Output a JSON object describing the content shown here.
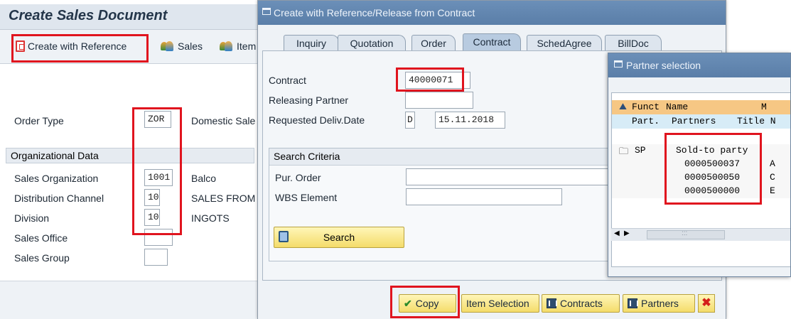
{
  "main": {
    "title": "Create Sales Document",
    "toolbar": {
      "create_with_reference": "Create with Reference",
      "sales": "Sales",
      "item": "Item"
    },
    "order_type": {
      "label": "Order Type",
      "value": "ZOR",
      "description": "Domestic Sale"
    },
    "org_section": "Organizational Data",
    "sales_org": {
      "label": "Sales Organization",
      "value": "1001",
      "description": "Balco"
    },
    "dist_channel": {
      "label": "Distribution Channel",
      "value": "10",
      "description": "SALES FROM"
    },
    "division": {
      "label": "Division",
      "value": "10",
      "description": "INGOTS"
    },
    "sales_office": {
      "label": "Sales Office",
      "value": ""
    },
    "sales_group": {
      "label": "Sales Group",
      "value": ""
    }
  },
  "ref_dialog": {
    "title": "Create with Reference/Release from Contract",
    "tabs": [
      "Inquiry",
      "Quotation",
      "Order",
      "Contract",
      "SchedAgree",
      "BillDoc"
    ],
    "active_tab": "Contract",
    "contract": {
      "label": "Contract",
      "value": "40000071"
    },
    "releasing_partner": {
      "label": "Releasing Partner",
      "value": ""
    },
    "req_deliv_date": {
      "label": "Requested Deliv.Date",
      "format": "D",
      "value": "15.11.2018"
    },
    "search_criteria": {
      "header": "Search Criteria",
      "pur_order": {
        "label": "Pur. Order",
        "value": ""
      },
      "wbs_element": {
        "label": "WBS Element",
        "value": ""
      },
      "search_button": "Search"
    },
    "footer": {
      "copy": "Copy",
      "item_selection": "Item Selection",
      "contracts": "Contracts",
      "partners": "Partners"
    }
  },
  "partner_dialog": {
    "title": "Partner selection",
    "header1": {
      "funct": "Funct",
      "name": "Name",
      "m": "M"
    },
    "header2": {
      "part": "Part.",
      "partners": "Partners",
      "title": "Title N"
    },
    "group": {
      "code": "SP",
      "name": "Sold-to party"
    },
    "rows": [
      {
        "partner": "0000500037",
        "extra": "A"
      },
      {
        "partner": "0000500050",
        "extra": "C"
      },
      {
        "partner": "0000500000",
        "extra": "E"
      }
    ],
    "scroll_mark": ":::"
  }
}
